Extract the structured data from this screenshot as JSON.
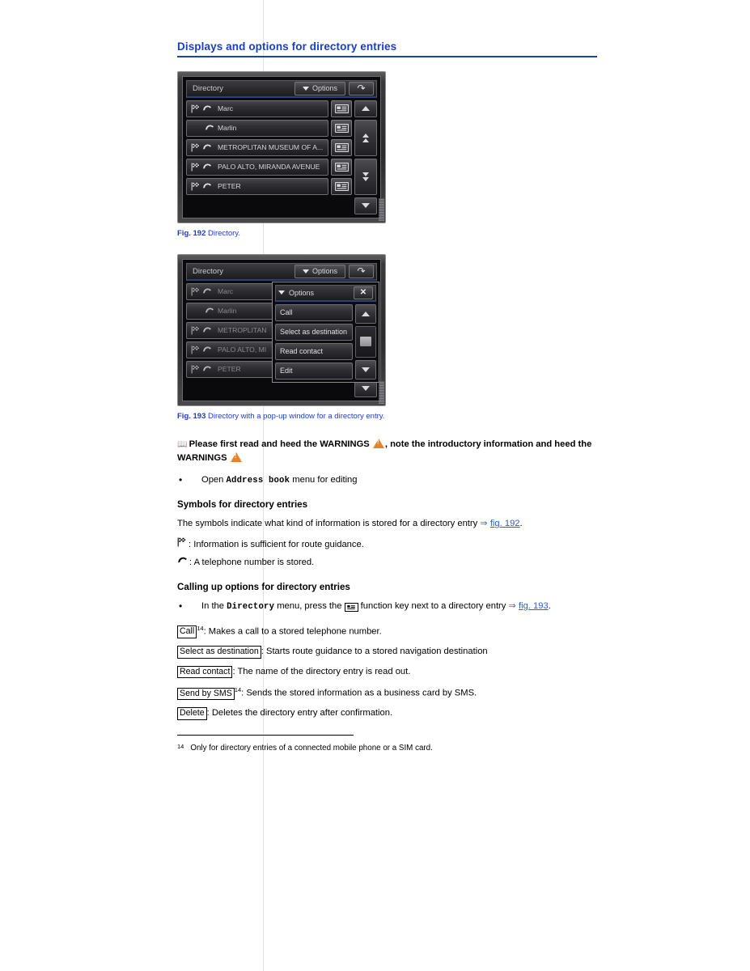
{
  "section": {
    "heading": "Displays and options for directory entries"
  },
  "figures": [
    {
      "id": "fig-192",
      "caption_label": "Fig. 192",
      "caption_text": "Directory.",
      "screen": {
        "title": "Directory",
        "options_button": "Options",
        "back_button": "back-arrow",
        "entries": [
          {
            "label": "Marc",
            "flag": true,
            "phone": true
          },
          {
            "label": "Marlin",
            "flag": false,
            "phone": true
          },
          {
            "label": "METROPLITAN MUSEUM OF A...",
            "flag": true,
            "phone": true
          },
          {
            "label": "PALO ALTO, MIRANDA AVENUE",
            "flag": true,
            "phone": true
          },
          {
            "label": "PETER",
            "flag": true,
            "phone": true
          }
        ],
        "scroll_buttons": [
          "arrow-up",
          "double-arrow-up",
          "double-arrow-down",
          "arrow-down"
        ]
      }
    },
    {
      "id": "fig-193",
      "caption_label": "Fig. 193",
      "caption_text": "Directory with a pop-up window for a directory entry.",
      "screen": {
        "title": "Directory",
        "options_button": "Options",
        "back_button": "back-arrow",
        "entries": [
          {
            "label": "Marc",
            "flag": true,
            "phone": true
          },
          {
            "label": "Marlin",
            "flag": false,
            "phone": true
          },
          {
            "label": "METROPLITAN",
            "flag": true,
            "phone": true
          },
          {
            "label": "PALO ALTO, MI",
            "flag": true,
            "phone": true
          },
          {
            "label": "PETER",
            "flag": true,
            "phone": true
          }
        ],
        "popup": {
          "title": "Options",
          "close_button": "close-icon",
          "items": [
            "Call",
            "Select as destination",
            "Read contact",
            "Edit"
          ],
          "scroll_buttons": [
            "arrow-up",
            "scroll-thumb",
            "arrow-down"
          ]
        }
      }
    }
  ],
  "warning": {
    "part1": "Please first read and heed the WARNINGS",
    "part2": ", note the introductory information and heed the WARNINGS"
  },
  "bullets_top": [
    {
      "pre": "Open ",
      "mono": "Address book",
      "post": " menu for editing"
    }
  ],
  "symbols_section": {
    "heading": "Symbols for directory entries",
    "intro_pre": "The symbols indicate what kind of information is stored for a directory entry ",
    "intro_arrow": "⇒ ",
    "intro_link": "fig. 192",
    "intro_post": ".",
    "lines": [
      {
        "icon": "checkered-flag-icon",
        "text": ": Information is sufficient for route guidance."
      },
      {
        "icon": "phone-handset-icon",
        "text": ": A telephone number is stored."
      }
    ]
  },
  "options_section": {
    "heading": "Calling up options for directory entries",
    "bullet": {
      "pre": "In the ",
      "mono": "Directory",
      "mid": " menu, press the ",
      "icon": "function-key-icon",
      "post": " function key next to a directory entry ",
      "arrow": "⇒ ",
      "link": "fig. 193",
      "end": "."
    },
    "definitions": [
      {
        "key": "Call",
        "footnote": "14",
        "text": ": Makes a call to a stored telephone number."
      },
      {
        "key": "Select as destination",
        "footnote": "",
        "text": ": Starts route guidance to a stored navigation destination"
      },
      {
        "key": "Read contact",
        "footnote": "",
        "text": ": The name of the directory entry is read out."
      },
      {
        "key": "Send by SMS",
        "footnote": "14",
        "text": ": Sends the stored information as a business card by SMS."
      },
      {
        "key": "Delete",
        "footnote": "",
        "text": ": Deletes the directory entry after confirmation."
      }
    ]
  },
  "footnote": {
    "number": "14",
    "text": "Only for directory entries of a connected mobile phone or a SIM card."
  },
  "colors": {
    "heading_blue": "#1a3fc4",
    "link_blue": "#2a5bd7",
    "warning_orange": "#e8822a"
  }
}
